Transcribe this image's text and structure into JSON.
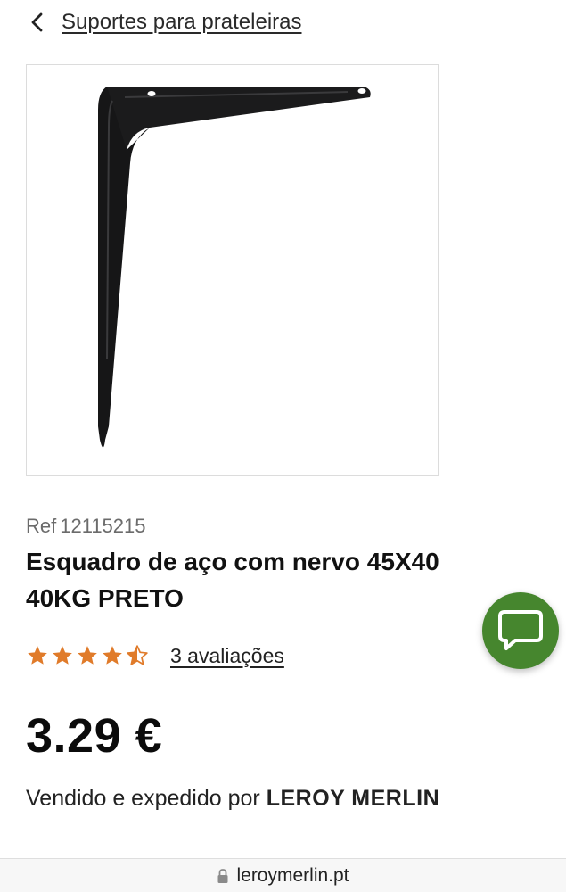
{
  "header": {
    "back_icon": "chevron-left-icon",
    "breadcrumb": "Suportes para prateleiras"
  },
  "product": {
    "image_alt": "black steel shelf bracket",
    "ref_label": "Ref",
    "ref_number": "12115215",
    "title": "Esquadro de aço com nervo 45X40 40KG PRETO",
    "rating": 4.5,
    "rating_max": 5,
    "reviews_link": "3 avaliações",
    "price": "3.29 €",
    "seller_prefix": "Vendido e expedido por",
    "seller_name": "LEROY MERLIN"
  },
  "chat": {
    "icon": "chat-bubble-icon"
  },
  "browser": {
    "lock_icon": "lock-icon",
    "url": "leroymerlin.pt"
  },
  "colors": {
    "star": "#e07b2a",
    "chat_bg": "#46862e",
    "text": "#1a1a1a",
    "muted": "#6b6b6b"
  }
}
